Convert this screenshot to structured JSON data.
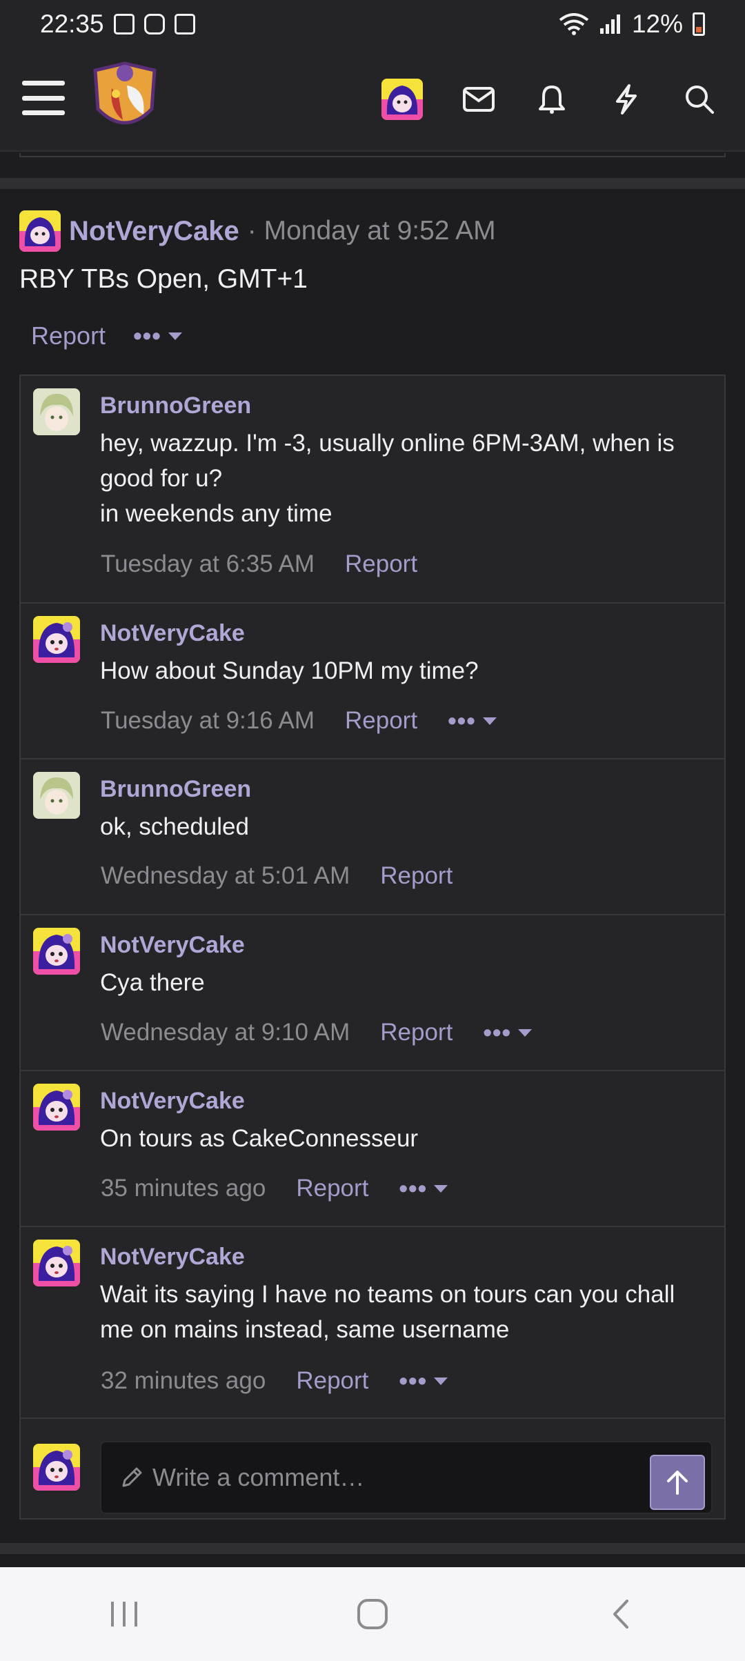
{
  "status_bar": {
    "time": "22:35",
    "battery": "12%"
  },
  "app_bar": {
    "icons": [
      "menu-icon",
      "forum-logo",
      "user-avatar",
      "mail-icon",
      "bell-icon",
      "lightning-icon",
      "search-icon"
    ]
  },
  "post": {
    "author": "NotVeryCake",
    "time": "· Monday at 9:52 AM",
    "body": "RBY TBs Open, GMT+1",
    "report": "Report",
    "more": "•••"
  },
  "comments": [
    {
      "author": "BrunnoGreen",
      "avatar": "green",
      "lines": [
        "hey, wazzup. I'm -3, usually online 6PM-3AM, when is good for u?",
        "in weekends any time"
      ],
      "date": "Tuesday at 6:35 AM",
      "report": "Report",
      "more": ""
    },
    {
      "author": "NotVeryCake",
      "avatar": "purple",
      "lines": [
        "How about Sunday 10PM my time?"
      ],
      "date": "Tuesday at 9:16 AM",
      "report": "Report",
      "more": "•••"
    },
    {
      "author": "BrunnoGreen",
      "avatar": "green",
      "lines": [
        "ok, scheduled"
      ],
      "date": "Wednesday at 5:01 AM",
      "report": "Report",
      "more": ""
    },
    {
      "author": "NotVeryCake",
      "avatar": "purple",
      "lines": [
        "Cya there"
      ],
      "date": "Wednesday at 9:10 AM",
      "report": "Report",
      "more": "•••"
    },
    {
      "author": "NotVeryCake",
      "avatar": "purple",
      "lines": [
        "On tours as CakeConnesseur"
      ],
      "date": "35 minutes ago",
      "report": "Report",
      "more": "•••"
    },
    {
      "author": "NotVeryCake",
      "avatar": "purple",
      "lines": [
        "Wait its saying I have no teams on tours can you chall me on mains instead, same username"
      ],
      "date": "32 minutes ago",
      "report": "Report",
      "more": "•••"
    }
  ],
  "comment_input": {
    "placeholder": "Write a comment…"
  },
  "colors": {
    "accent": "#b1a7d6",
    "link": "#a69ccb",
    "background": "#1d1c1f",
    "button": "#7b6fa7"
  }
}
